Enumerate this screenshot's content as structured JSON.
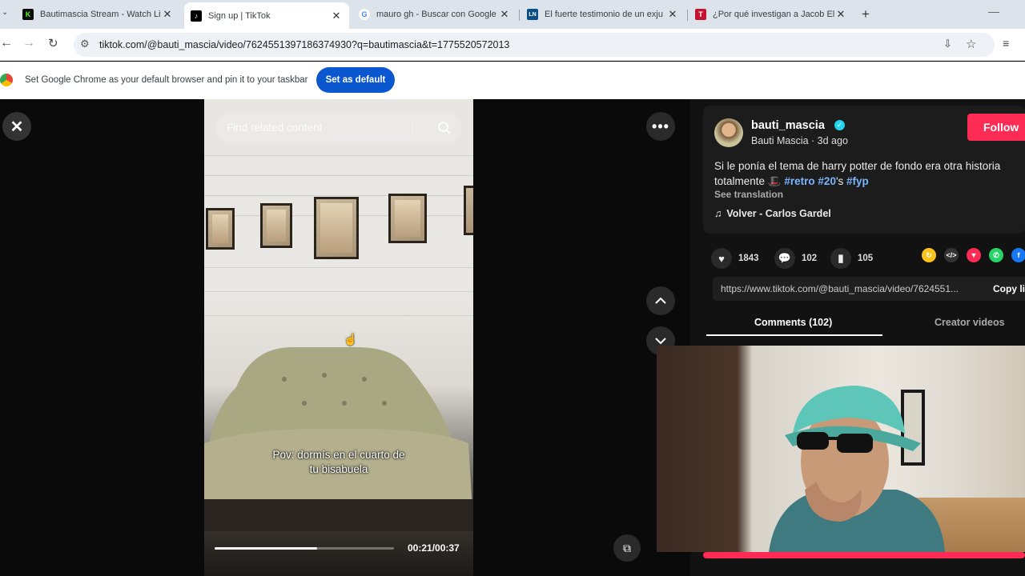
{
  "browser": {
    "tabs": [
      {
        "title": "Bautimascia Stream - Watch Liv",
        "favicon_color": "#53fc18",
        "active": false
      },
      {
        "title": "Sign up | TikTok",
        "favicon_color": "#000000",
        "active": true
      },
      {
        "title": "mauro gh - Buscar con Google",
        "favicon_color": "#4285f4",
        "active": false
      },
      {
        "title": "El fuerte testimonio de un exju",
        "favicon_color": "#0b4f8a",
        "active": false
      },
      {
        "title": "¿Por qué investigan a Jacob Elo",
        "favicon_color": "#c4122f",
        "active": false
      }
    ],
    "url": "tiktok.com/@bauti_mascia/video/7624551397186374930?q=bautimascia&t=1775520572013",
    "infobar_text": "Set Google Chrome as your default browser and pin it to your taskbar",
    "infobar_button": "Set as default"
  },
  "video": {
    "search_placeholder": "Find related content",
    "caption_line1": "Pov: dormís en el cuarto de",
    "caption_line2": "tu bisabuela",
    "time": "00:21/00:37",
    "progress_fraction": 0.57
  },
  "post": {
    "username": "bauti_mascia",
    "display_name_date": "Bauti Mascia · 3d ago",
    "follow_label": "Follow",
    "description": "Si le ponía el tema de harry potter de fondo era otra historia",
    "description_line2": "totalmente",
    "hashtag_retro": "#retro",
    "hashtag_20": "#20",
    "apostrophe_s": "'s",
    "hashtag_fyp": "#fyp",
    "see_translation": "See translation",
    "music": "Volver - Carlos Gardel",
    "likes": "1843",
    "comments": "102",
    "saves": "105",
    "share_link": "https://www.tiktok.com/@bauti_mascia/video/7624551...",
    "copy_link": "Copy li",
    "tab_comments": "Comments (102)",
    "tab_creator": "Creator videos"
  },
  "colors": {
    "accent": "#fe2c55",
    "hashtag": "#7ab4ff",
    "verified": "#20d5ec",
    "chrome_button": "#0b57d0"
  }
}
